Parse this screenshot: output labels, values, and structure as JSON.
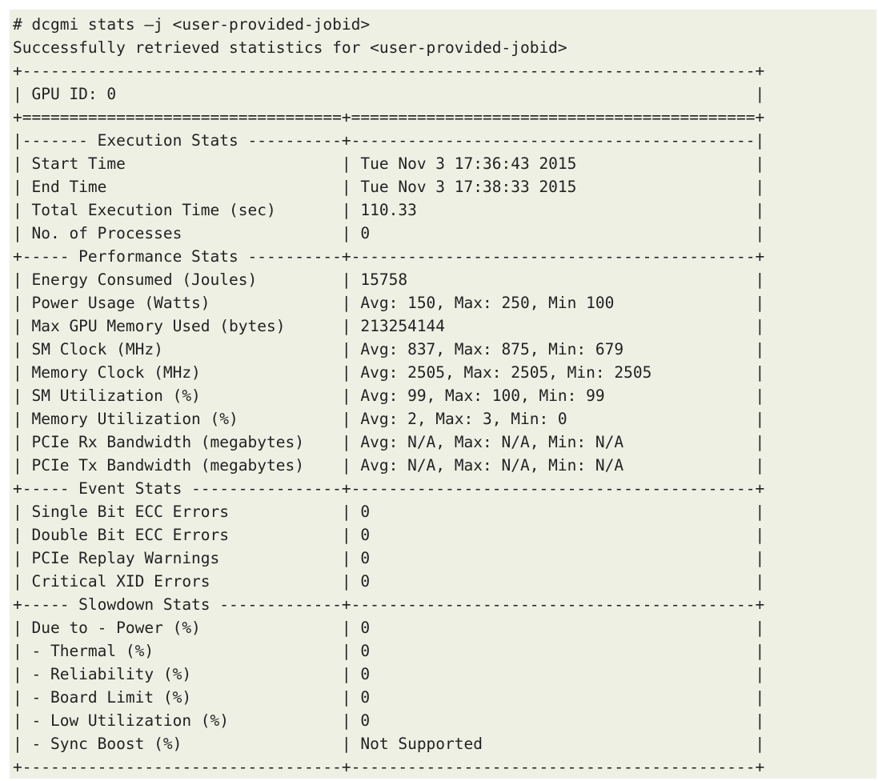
{
  "terminal": {
    "lines": [
      "# dcgmi stats –j <user-provided-jobid>",
      "Successfully retrieved statistics for <user-provided-jobid>",
      "+------------------------------------------------------------------------------+",
      "| GPU ID: 0                                                                    |",
      "+==================================+===========================================+",
      "|------- Execution Stats ----------+-------------------------------------------|",
      "| Start Time                       | Tue Nov 3 17:36:43 2015                   |",
      "| End Time                         | Tue Nov 3 17:38:33 2015                   |",
      "| Total Execution Time (sec)       | 110.33                                    |",
      "| No. of Processes                 | 0                                         |",
      "+----- Performance Stats ----------+-------------------------------------------+",
      "| Energy Consumed (Joules)         | 15758                                     |",
      "| Power Usage (Watts)              | Avg: 150, Max: 250, Min 100               |",
      "| Max GPU Memory Used (bytes)      | 213254144                                 |",
      "| SM Clock (MHz)                   | Avg: 837, Max: 875, Min: 679              |",
      "| Memory Clock (MHz)               | Avg: 2505, Max: 2505, Min: 2505           |",
      "| SM Utilization (%)               | Avg: 99, Max: 100, Min: 99                |",
      "| Memory Utilization (%)           | Avg: 2, Max: 3, Min: 0                    |",
      "| PCIe Rx Bandwidth (megabytes)    | Avg: N/A, Max: N/A, Min: N/A              |",
      "| PCIe Tx Bandwidth (megabytes)    | Avg: N/A, Max: N/A, Min: N/A              |",
      "+----- Event Stats ----------------+-------------------------------------------+",
      "| Single Bit ECC Errors            | 0                                         |",
      "| Double Bit ECC Errors            | 0                                         |",
      "| PCIe Replay Warnings             | 0                                         |",
      "| Critical XID Errors              | 0                                         |",
      "+----- Slowdown Stats -------------+-------------------------------------------+",
      "| Due to - Power (%)               | 0                                         |",
      "| - Thermal (%)                    | 0                                         |",
      "| - Reliability (%)                | 0                                         |",
      "| - Board Limit (%)                | 0                                         |",
      "| - Low Utilization (%)            | 0                                         |",
      "| - Sync Boost (%)                 | Not Supported                             |",
      "+----------------------------------+-------------------------------------------+"
    ]
  }
}
